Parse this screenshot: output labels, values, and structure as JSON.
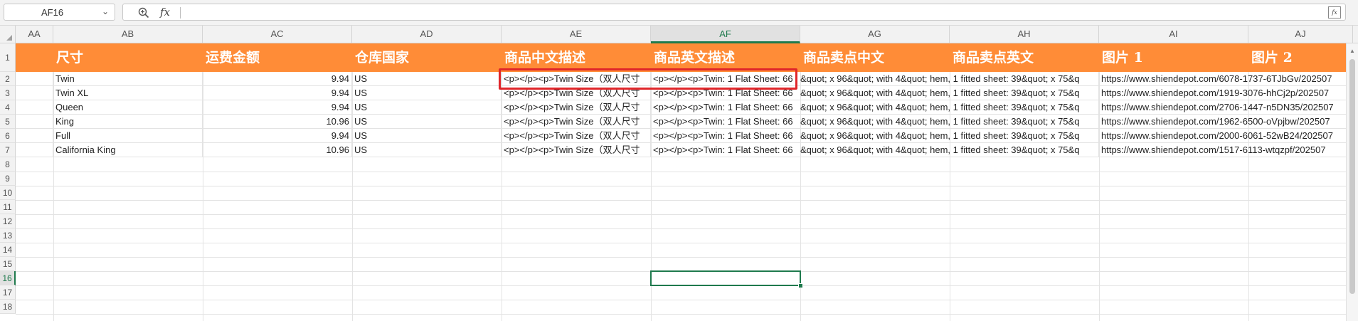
{
  "formula_bar": {
    "name_box": "AF16",
    "name_box_caret": "⌄",
    "fx_label": "fx",
    "formula_value": "",
    "expand_label": "fx"
  },
  "columns": [
    "AA",
    "AB",
    "AC",
    "AD",
    "AE",
    "AF",
    "AG",
    "AH",
    "AI",
    "AJ"
  ],
  "active_column": "AF",
  "rows": [
    "1",
    "2",
    "3",
    "4",
    "5",
    "6",
    "7",
    "8",
    "9",
    "10",
    "11",
    "12",
    "13",
    "14",
    "15",
    "16",
    "17",
    "18"
  ],
  "active_row": "16",
  "header_cells": [
    "",
    "尺寸",
    "运费金额",
    "仓库国家",
    "商品中文描述",
    "商品英文描述",
    "商品卖点中文",
    "商品卖点英文",
    "图片 1",
    "图片 2"
  ],
  "data_rows": [
    {
      "size": "Twin",
      "fee": "9.94",
      "country": "US",
      "cn_desc": "<p></p><p>Twin Size（双人尺寸",
      "en_desc": "<p></p><p>Twin: 1 Flat Sheet: 66",
      "cn_points": "&quot; x 96&quot; with 4&quot; hem, 1 fitted sheet: 39&quot; x 75&q",
      "en_points": "",
      "img1": "https://www.shiendepot.com/6078-1737-6TJbGv/202507",
      "img2": ""
    },
    {
      "size": "Twin XL",
      "fee": "9.94",
      "country": "US",
      "cn_desc": "<p></p><p>Twin Size（双人尺寸",
      "en_desc": "<p></p><p>Twin: 1 Flat Sheet: 66",
      "cn_points": "&quot; x 96&quot; with 4&quot; hem, 1 fitted sheet: 39&quot; x 75&q",
      "en_points": "",
      "img1": "https://www.shiendepot.com/1919-3076-hhCj2p/202507",
      "img2": ""
    },
    {
      "size": "Queen",
      "fee": "9.94",
      "country": "US",
      "cn_desc": "<p></p><p>Twin Size（双人尺寸",
      "en_desc": "<p></p><p>Twin: 1 Flat Sheet: 66",
      "cn_points": "&quot; x 96&quot; with 4&quot; hem, 1 fitted sheet: 39&quot; x 75&q",
      "en_points": "",
      "img1": "https://www.shiendepot.com/2706-1447-n5DN35/202507",
      "img2": ""
    },
    {
      "size": "King",
      "fee": "10.96",
      "country": "US",
      "cn_desc": "<p></p><p>Twin Size（双人尺寸",
      "en_desc": "<p></p><p>Twin: 1 Flat Sheet: 66",
      "cn_points": "&quot; x 96&quot; with 4&quot; hem, 1 fitted sheet: 39&quot; x 75&q",
      "en_points": "",
      "img1": "https://www.shiendepot.com/1962-6500-oVpjbw/202507",
      "img2": ""
    },
    {
      "size": "Full",
      "fee": "9.94",
      "country": "US",
      "cn_desc": "<p></p><p>Twin Size（双人尺寸",
      "en_desc": "<p></p><p>Twin: 1 Flat Sheet: 66",
      "cn_points": "&quot; x 96&quot; with 4&quot; hem, 1 fitted sheet: 39&quot; x 75&q",
      "en_points": "",
      "img1": "https://www.shiendepot.com/2000-6061-52wB24/202507",
      "img2": ""
    },
    {
      "size": "California King",
      "fee": "10.96",
      "country": "US",
      "cn_desc": "<p></p><p>Twin Size（双人尺寸",
      "en_desc": "<p></p><p>Twin: 1 Flat Sheet: 66",
      "cn_points": "&quot; x 96&quot; with 4&quot; hem, 1 fitted sheet: 39&quot; x 75&q",
      "en_points": "",
      "img1": "https://www.shiendepot.com/1517-6113-wtqzpf/202507",
      "img2": ""
    }
  ],
  "icons": {
    "zoom": "magnifier-icon",
    "select_all": "select-all-triangle-icon",
    "expand": "expand-formula-icon"
  },
  "colors": {
    "header_fill": "#ff8c37",
    "active_green": "#1f7a4d",
    "highlight_red": "#e0262a"
  }
}
